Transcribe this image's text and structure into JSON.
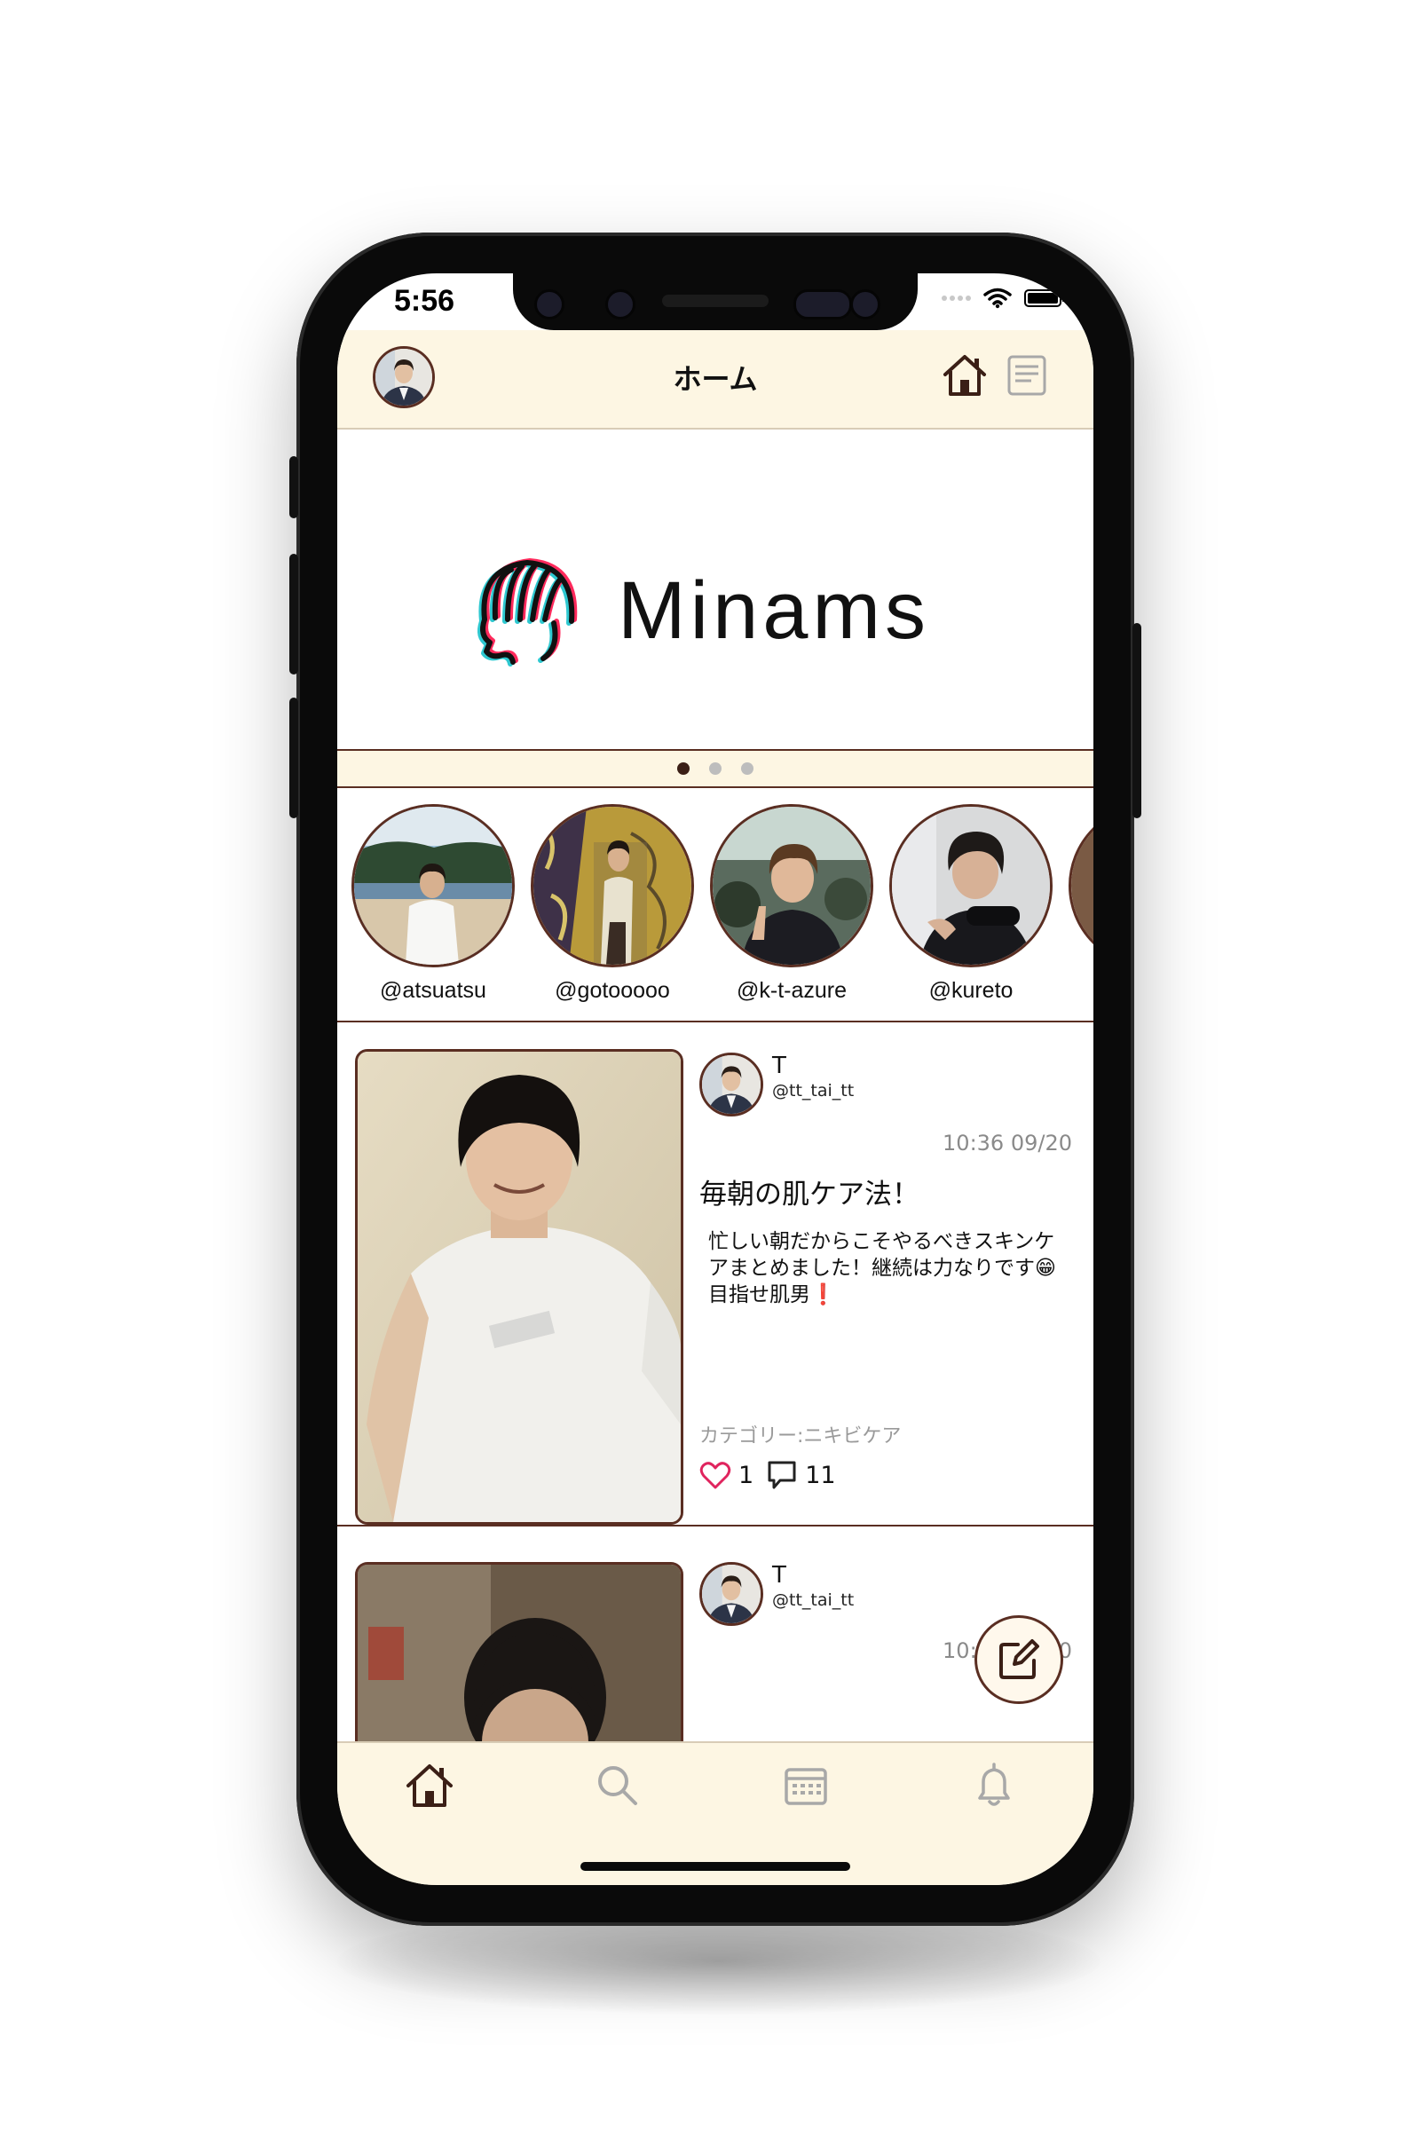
{
  "status_bar": {
    "time": "5:56"
  },
  "header": {
    "title": "ホーム"
  },
  "banner": {
    "brand": "Minams",
    "page_count": 3,
    "active_page": 1
  },
  "stories": [
    {
      "handle": "@atsuatsu"
    },
    {
      "handle": "@gotooooo"
    },
    {
      "handle": "@k-t-azure"
    },
    {
      "handle": "@kureto"
    }
  ],
  "posts": [
    {
      "name": "T",
      "handle": "@tt_tai_tt",
      "time": "10:36 09/20",
      "title": "毎朝の肌ケア法！",
      "body": "忙しい朝だからこそやるべきスキンケアまとめました！継続は力なりです😁目指せ肌男❗",
      "category": "カテゴリー:ニキビケア",
      "likes": "1",
      "comments": "11"
    },
    {
      "name": "T",
      "handle": "@tt_tai_tt",
      "time": "10:33 09/20"
    }
  ],
  "tabs": [
    {
      "icon": "home-icon",
      "active": true
    },
    {
      "icon": "search-icon",
      "active": false
    },
    {
      "icon": "calendar-icon",
      "active": false
    },
    {
      "icon": "bell-icon",
      "active": false
    }
  ],
  "colors": {
    "accent": "#5a2e22",
    "header_bg": "#fdf6e3",
    "like": "#e0245e",
    "inactive_icon": "#a8a8a8"
  }
}
